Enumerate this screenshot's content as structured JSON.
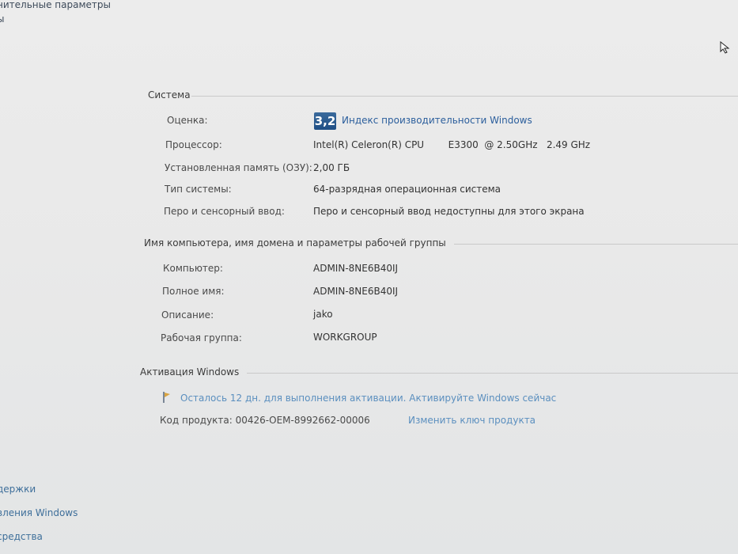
{
  "sidebar": {
    "top_items": [
      "нительные параметры",
      "ы"
    ],
    "bottom_items": [
      "держки",
      "вления Windows",
      "средства"
    ]
  },
  "system": {
    "section_title": "Система",
    "rating_label": "Оценка:",
    "rating_value": "3,2",
    "rating_link": "Индекс производительности Windows",
    "processor_label": "Процессор:",
    "processor_value": "Intel(R) Celeron(R) CPU        E3300  @ 2.50GHz   2.49 GHz",
    "ram_label": "Установленная память (ОЗУ):",
    "ram_value": "2,00 ГБ",
    "type_label": "Тип системы:",
    "type_value": "64-разрядная операционная система",
    "pen_label": "Перо и сенсорный ввод:",
    "pen_value": "Перо и сенсорный ввод недоступны для этого экрана"
  },
  "computer": {
    "section_title": "Имя компьютера, имя домена и параметры рабочей группы",
    "computer_label": "Компьютер:",
    "computer_value": "ADMIN-8NE6B40IJ",
    "fullname_label": "Полное имя:",
    "fullname_value": "ADMIN-8NE6B40IJ",
    "description_label": "Описание:",
    "description_value": "jako",
    "workgroup_label": "Рабочая группа:",
    "workgroup_value": "WORKGROUP"
  },
  "activation": {
    "section_title": "Активация Windows",
    "status_link": "Осталось 12 дн. для выполнения активации. Активируйте Windows сейчас",
    "product_key_label": "Код продукта:  00426-OEM-8992662-00006",
    "change_key_link": "Изменить ключ продукта"
  },
  "colors": {
    "link": "#2b5e9c",
    "rating_badge": "#1f4f86"
  }
}
